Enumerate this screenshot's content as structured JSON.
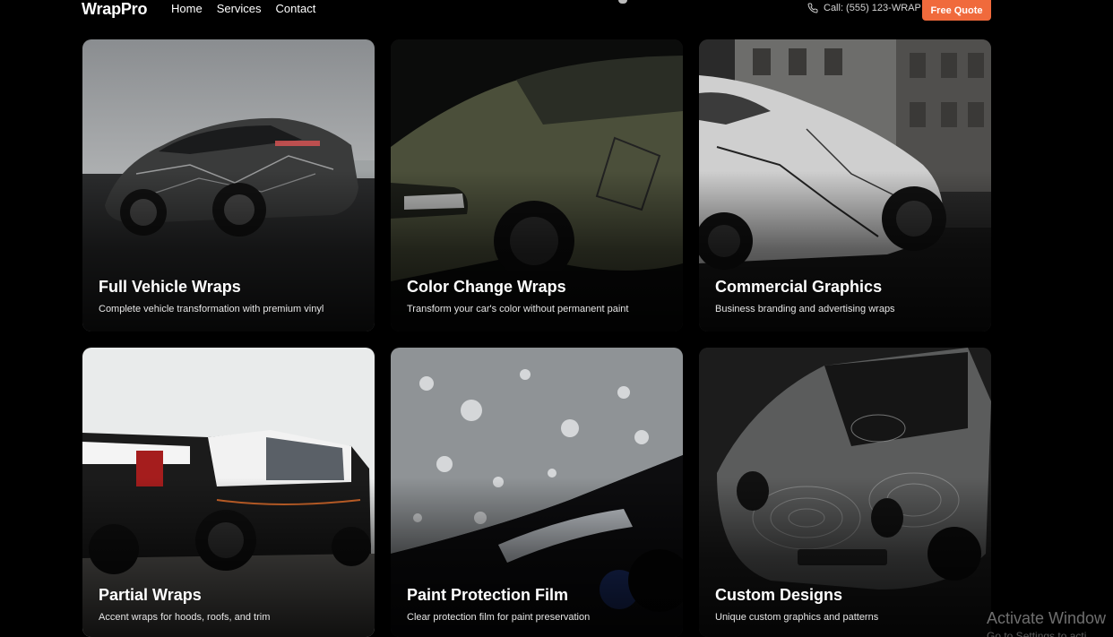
{
  "header": {
    "logo": "WrapPro",
    "nav": [
      "Home",
      "Services",
      "Contact"
    ],
    "phone": "Call: (555) 123-WRAP",
    "cta": "Free Quote"
  },
  "services": [
    {
      "title": "Full Vehicle Wraps",
      "desc": "Complete vehicle transformation with premium vinyl"
    },
    {
      "title": "Color Change Wraps",
      "desc": "Transform your car's color without permanent paint"
    },
    {
      "title": "Commercial Graphics",
      "desc": "Business branding and advertising wraps"
    },
    {
      "title": "Partial Wraps",
      "desc": "Accent wraps for hoods, roofs, and trim"
    },
    {
      "title": "Paint Protection Film",
      "desc": "Clear protection film for paint preservation"
    },
    {
      "title": "Custom Designs",
      "desc": "Unique custom graphics and patterns"
    }
  ],
  "watermark": {
    "line1": "Activate Window",
    "line2": "Go to Settings to acti"
  },
  "colors": {
    "accent": "#f06a3c",
    "background": "#000000"
  }
}
